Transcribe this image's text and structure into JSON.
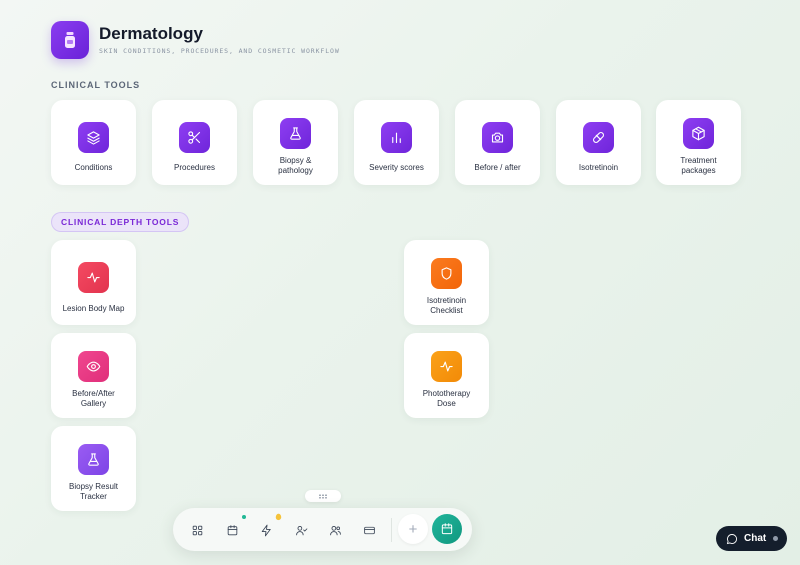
{
  "header": {
    "title": "Dermatology",
    "subtitle": "SKIN CONDITIONS, PROCEDURES, AND COSMETIC WORKFLOW",
    "icon": "bottle-icon"
  },
  "clinical_tools": {
    "title": "CLINICAL TOOLS",
    "items": [
      {
        "label": "Conditions",
        "icon": "layers-icon"
      },
      {
        "label": "Procedures",
        "icon": "scissors-icon"
      },
      {
        "label": "Biopsy & pathology",
        "icon": "flask-icon"
      },
      {
        "label": "Severity scores",
        "icon": "bar-chart-icon"
      },
      {
        "label": "Before / after",
        "icon": "camera-icon"
      },
      {
        "label": "Isotretinoin",
        "icon": "pill-icon"
      },
      {
        "label": "Treatment packages",
        "icon": "package-icon"
      }
    ]
  },
  "depth_tools": {
    "title": "CLINICAL DEPTH TOOLS",
    "items": [
      {
        "label": "Lesion Body Map",
        "icon": "activity-icon",
        "color": "#ee3f58"
      },
      {
        "label": "Before/After Gallery",
        "icon": "eye-icon",
        "color": "#e93a86"
      },
      {
        "label": "Biopsy Result Tracker",
        "icon": "flask-icon",
        "color": "#8b50ec"
      },
      {
        "label": "Isotretinoin Checklist",
        "icon": "shield-icon",
        "color": "#f77014"
      },
      {
        "label": "Phototherapy Dose",
        "icon": "activity-icon",
        "color": "#f69610"
      }
    ]
  },
  "dock": {
    "items": [
      "grid-icon",
      "calendar-icon",
      "bolt-icon",
      "user-check-icon",
      "users-icon",
      "card-icon"
    ],
    "add_label": "+",
    "accent": "#17a78d"
  },
  "chat": {
    "label": "Chat"
  }
}
